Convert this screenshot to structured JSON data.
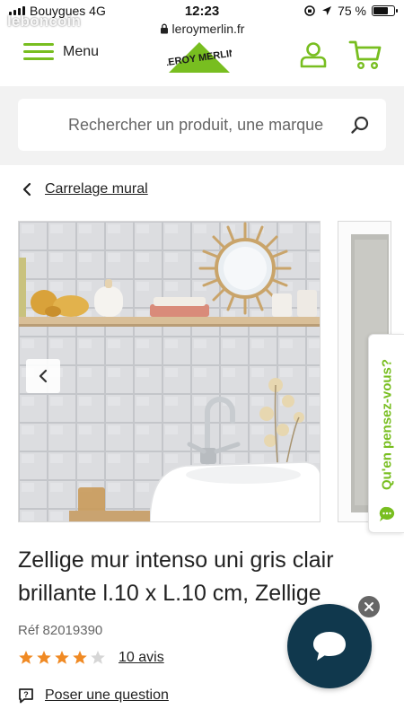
{
  "status_bar": {
    "carrier": "Bouygues  4G",
    "time": "12:23",
    "battery_text": "75 %",
    "battery_level": 0.75
  },
  "browser": {
    "url": "leroymerlin.fr"
  },
  "watermark": "leboncoin",
  "header": {
    "menu_label": "Menu",
    "logo_text": "LEROY MERLIN",
    "account_icon": "user-icon",
    "cart_icon": "cart-icon",
    "brand_color": "#78be20"
  },
  "search": {
    "placeholder": "Rechercher un produit, une marque",
    "icon": "search-icon"
  },
  "breadcrumb": {
    "label": "Carrelage mural",
    "icon": "chevron-left-icon"
  },
  "gallery": {
    "prev_icon": "chevron-left-icon",
    "images": [
      "Zellige wall with mirror, shelf and washbasin",
      "Single zellige tile"
    ]
  },
  "side_tab": {
    "label": "Qu'en pensez-vous?",
    "icon": "feedback-icon"
  },
  "product": {
    "title": "Zellige mur intenso uni gris clair brillante l.10 x L.10 cm, Zellige",
    "ref": "Réf 82019390",
    "rating": 4,
    "rating_max": 5,
    "reviews": "10 avis",
    "question": "Poser une question",
    "star_color": "#f08a24"
  },
  "chat": {
    "color": "#10384d",
    "icon": "chat-bubble-icon",
    "close_icon": "close-icon"
  }
}
